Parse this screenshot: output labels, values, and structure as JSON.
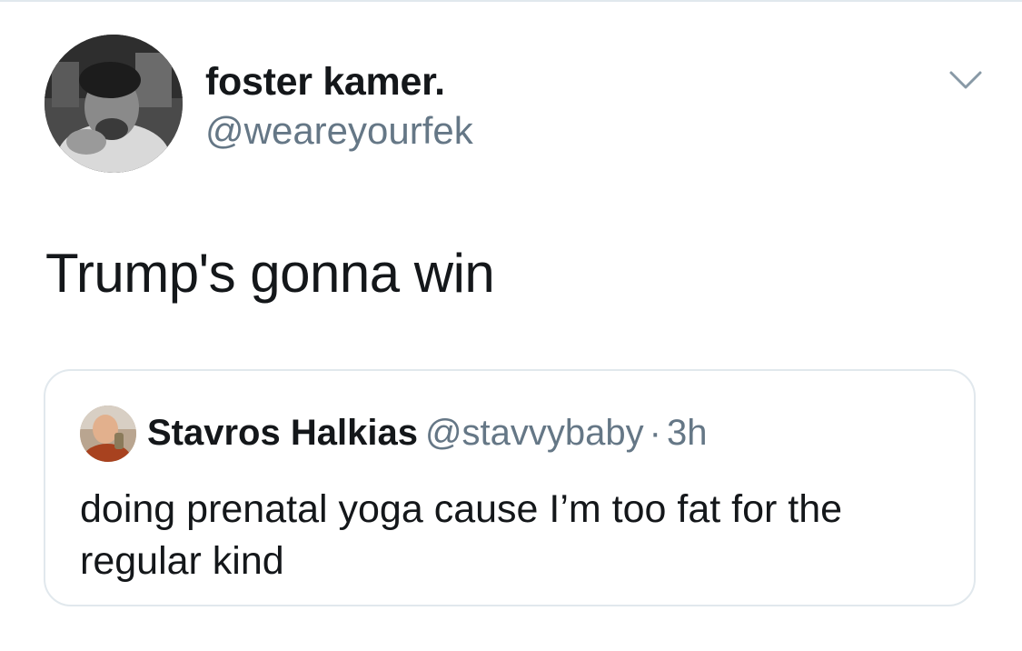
{
  "tweet": {
    "author": {
      "display_name": "foster kamer.",
      "handle": "@weareyourfek",
      "avatar_icon": "profile-photo"
    },
    "menu_icon": "chevron-down-icon",
    "text": "Trump's gonna win",
    "quoted_tweet": {
      "author": {
        "display_name": "Stavros Halkias",
        "handle": "@stavvybaby",
        "avatar_icon": "profile-photo"
      },
      "separator": "·",
      "time": "3h",
      "text": "doing prenatal yoga cause I’m too fat for the regular kind"
    }
  },
  "colors": {
    "text_primary": "#14171a",
    "text_secondary": "#657786",
    "border": "#e1e8ed",
    "background": "#ffffff"
  }
}
